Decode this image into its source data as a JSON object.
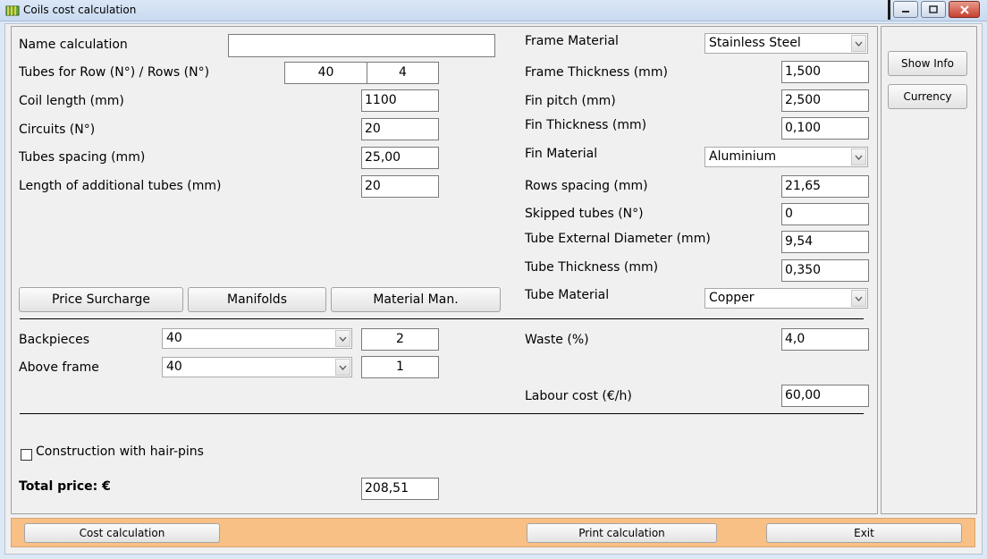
{
  "window": {
    "title": "Coils cost calculation"
  },
  "icons": {
    "app": "coil-app-icon",
    "minimize": "minimize-icon",
    "maximize": "maximize-icon",
    "close": "close-icon",
    "dropdown": "chevron-down-icon",
    "checkbox": "checkbox-unchecked"
  },
  "left": {
    "name_calculation": {
      "label": "Name calculation",
      "value": ""
    },
    "tubes_rows": {
      "label": "Tubes for Row (N°) / Rows (N°)",
      "tubes_value": "40",
      "rows_value": "4"
    },
    "coil_length": {
      "label": "Coil length (mm)",
      "value": "1100"
    },
    "circuits": {
      "label": "Circuits (N°)",
      "value": "20"
    },
    "tubes_spacing": {
      "label": "Tubes spacing (mm)",
      "value": "25,00"
    },
    "additional_tubes": {
      "label": "Length of additional tubes (mm)",
      "value": "20"
    },
    "buttons": {
      "price_surcharge": "Price Surcharge",
      "manifolds": "Manifolds",
      "material_man": "Material Man."
    },
    "backpieces": {
      "label": "Backpieces",
      "select": "40",
      "value": "2"
    },
    "above_frame": {
      "label": "Above frame",
      "select": "40",
      "value": "1"
    },
    "hairpins": {
      "label": "Construction with hair-pins",
      "checked": false
    },
    "total_price": {
      "label": "Total price: €",
      "value": "208,51"
    }
  },
  "right": {
    "frame_material": {
      "label": "Frame Material",
      "value": "Stainless Steel"
    },
    "frame_thickness": {
      "label": "Frame Thickness (mm)",
      "value": "1,500"
    },
    "fin_pitch": {
      "label": "Fin pitch (mm)",
      "value": "2,500"
    },
    "fin_thickness": {
      "label": "Fin Thickness (mm)",
      "value": "0,100"
    },
    "fin_material": {
      "label": "Fin Material",
      "value": "Aluminium"
    },
    "rows_spacing": {
      "label": "Rows spacing (mm)",
      "value": "21,65"
    },
    "skipped_tubes": {
      "label": "Skipped tubes  (N°)",
      "value": "0"
    },
    "tube_ext_diameter": {
      "label": "Tube External Diameter (mm)",
      "value": "9,54"
    },
    "tube_thickness": {
      "label": "Tube Thickness (mm)",
      "value": "0,350"
    },
    "tube_material": {
      "label": "Tube Material",
      "value": "Copper"
    },
    "waste": {
      "label": "Waste (%)",
      "value": "4,0"
    },
    "labour_cost": {
      "label": "Labour cost (€/h)",
      "value": "60,00"
    }
  },
  "side": {
    "show_info": "Show Info",
    "currency": "Currency"
  },
  "footer": {
    "cost_calculation": "Cost calculation",
    "print_calculation": "Print calculation",
    "exit": "Exit"
  },
  "colors": {
    "bottom_bar": "#f8c085",
    "title_bar": "#c9daf0",
    "close_button": "#c8412f"
  }
}
